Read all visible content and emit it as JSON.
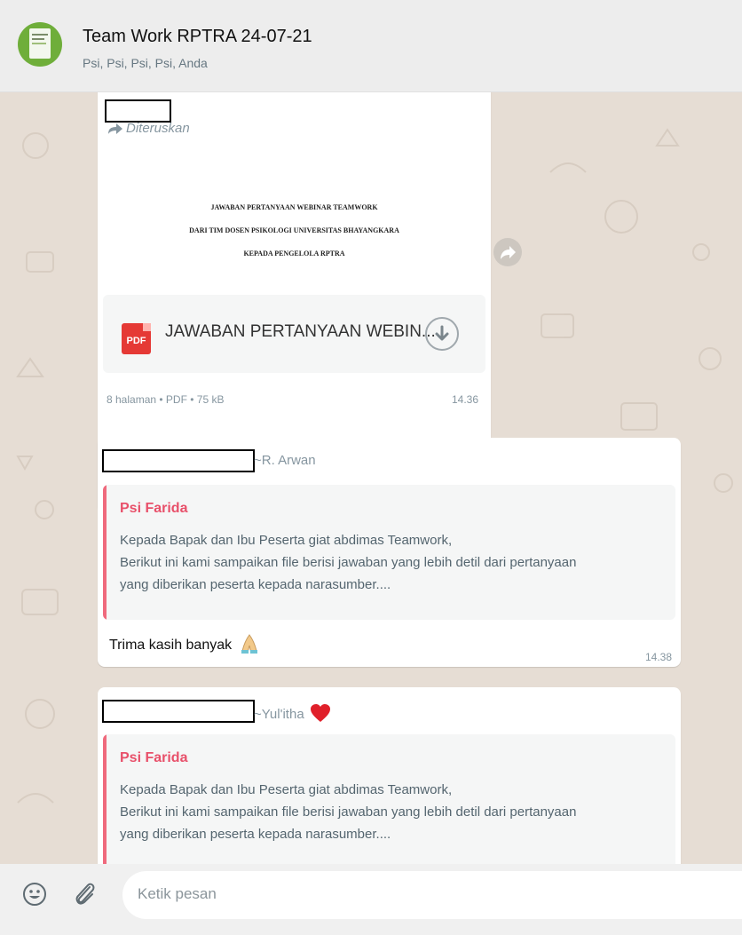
{
  "header": {
    "title": "Team Work RPTRA 24-07-21",
    "participants": "Psi, Psi, Psi, Psi, Anda"
  },
  "messages": {
    "doc": {
      "forwarded_label": "Diteruskan",
      "preview_lines": [
        "JAWABAN PERTANYAAN WEBINAR TEAMWORK",
        "DARI TIM DOSEN PSIKOLOGI UNIVERSITAS BHAYANGKARA",
        "KEPADA PENGELOLA RPTRA"
      ],
      "file_badge": "PDF",
      "file_name": "JAWABAN PERTANYAAN WEBIN...",
      "meta": "8 halaman • PDF • 75 kB",
      "time": "14.36"
    },
    "reply1": {
      "sender": "~R. Arwan",
      "quoted_name": "Psi Farida",
      "quoted_text": "Kepada Bapak dan Ibu Peserta giat abdimas Teamwork,\nBerikut ini kami sampaikan file berisi jawaban yang lebih detil dari pertanyaan\nyang diberikan peserta kepada narasumber....",
      "text": "Trima kasih banyak",
      "time": "14.38"
    },
    "reply2": {
      "sender": "~Yul'itha",
      "quoted_name": "Psi Farida",
      "quoted_text": "Kepada Bapak dan Ibu Peserta giat abdimas Teamwork,\nBerikut ini kami sampaikan file berisi jawaban yang lebih detil dari pertanyaan\nyang diberikan peserta kepada narasumber...."
    }
  },
  "composer": {
    "placeholder": "Ketik pesan"
  },
  "icons": [
    "group-avatar",
    "forward-icon",
    "pdf-icon",
    "download-icon",
    "share-icon",
    "praying-hands-emoji",
    "heart-emoji",
    "emoji-icon",
    "paperclip-icon"
  ],
  "colors": {
    "header_bg": "#ededed",
    "chat_bg": "#e6ddd4",
    "quote_accent": "#ef6a7d",
    "quote_name": "#e8506a",
    "composer_bg": "#f0f0f0"
  }
}
